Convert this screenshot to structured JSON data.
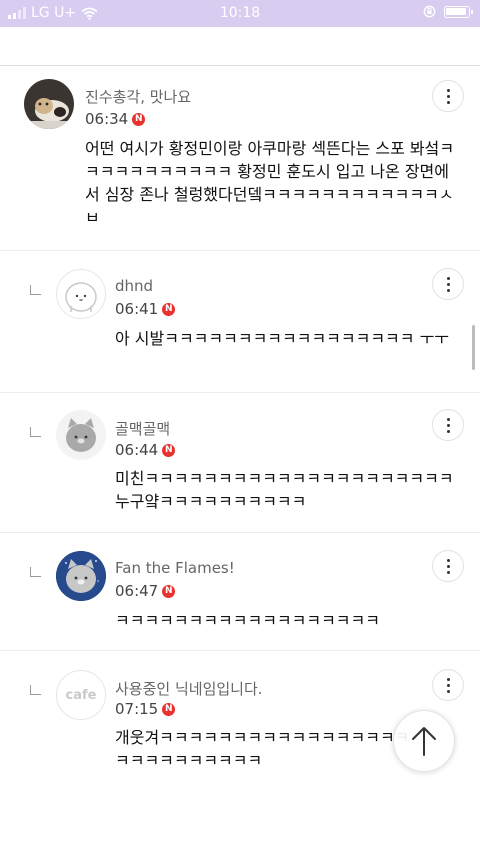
{
  "status_bar": {
    "carrier": "LG U+",
    "time": "10:18",
    "icons": [
      "signal-icon",
      "wifi-icon",
      "rotation-lock-icon",
      "battery-icon"
    ]
  },
  "comments": [
    {
      "nickname": "진수총각, 맛나요",
      "time": "06:34",
      "badge": "N",
      "text": "어떤 여시가 황정민이랑 아쿠마랑 섹뜬다는 스포 봐섴ㅋㅋㅋㅋㅋㅋㅋㅋㅋㅋㅋ 황정민 훈도시 입고 나온 장면에서 심장 존나 철렁했다던뎈ㅋㅋㅋㅋㅋㅋㅋㅋㅋㅋㅋㅋㅅㅂ",
      "avatar": "cat-photo-avatar",
      "is_reply": false
    },
    {
      "nickname": "dhnd",
      "time": "06:41",
      "badge": "N",
      "text": "아 시발ㅋㅋㅋㅋㅋㅋㅋㅋㅋㅋㅋㅋㅋㅋㅋㅋㅋ ㅜㅜ",
      "avatar": "default-white-avatar",
      "is_reply": true
    },
    {
      "nickname": "골맥골맥",
      "time": "06:44",
      "badge": "N",
      "text": "미친ㅋㅋㅋㅋㅋㅋㅋㅋㅋㅋㅋㅋㅋㅋㅋㅋㅋㅋㅋㅋㅋ누구얔ㅋㅋㅋㅋㅋㅋㅋㅋㅋㅋ",
      "avatar": "default-gray-avatar",
      "is_reply": true
    },
    {
      "nickname": "Fan the Flames!",
      "time": "06:47",
      "badge": "N",
      "text": "ㅋㅋㅋㅋㅋㅋㅋㅋㅋㅋㅋㅋㅋㅋㅋㅋㅋㅋ",
      "avatar": "default-blue-avatar",
      "is_reply": true
    },
    {
      "nickname": "사용중인 닉네임입니다.",
      "time": "07:15",
      "badge": "N",
      "text": "개웃겨ㅋㅋㅋㅋㅋㅋㅋㅋㅋㅋㅋㅋㅋㅋㅋㅋㅋㅋㅋㅋㅋㅋㅋㅋㅋㅋㅋ",
      "avatar": "cafe-logo-avatar",
      "avatar_text": "cafe",
      "is_reply": true
    }
  ],
  "floating": {
    "scroll_top_icon": "arrow-up-icon"
  },
  "colors": {
    "status_bar": "#d9ccf1",
    "badge": "#e8322f"
  }
}
